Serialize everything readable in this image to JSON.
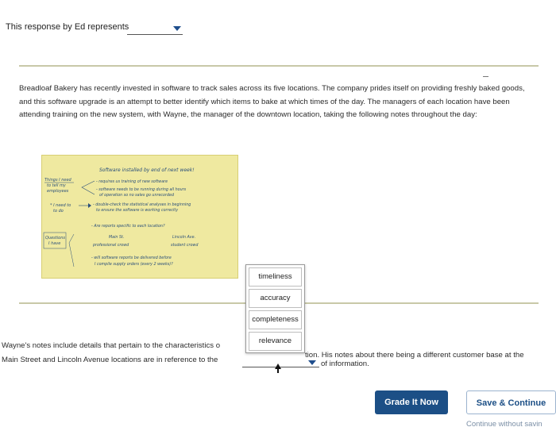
{
  "question": {
    "prompt": "This response by Ed represents",
    "paragraph": "Breadloaf Bakery has recently invested in software to track sales across its five locations. The company prides itself on providing freshly baked goods, and this software upgrade is an attempt to better identify which items to bake at which times of the day. The managers of each location have been attending training on the new system, with Wayne, the manager of the downtown location, taking the following notes throughout the day:"
  },
  "notes_card": {
    "title": "Software installed by end of next week!",
    "left_labels": [
      "Things I need to tell my employees",
      "* I need to do",
      "Questions I have"
    ],
    "lines": [
      "- requires us training of new software",
      "- software needs to be running during all hours",
      "of operation so no sales go unrecorded",
      "- double-check the statistical analyses in beginning",
      "to ensure the software is working correctly",
      "- Are reports specific to each location?",
      "Main St.",
      "Lincoln Ave.",
      "professional crowd",
      "student crowd",
      "- will software reports be delivered before",
      "I compile supply orders (every 2 weeks)?"
    ]
  },
  "dropdown": {
    "options": [
      "timeliness",
      "accuracy",
      "completeness",
      "relevance"
    ]
  },
  "answer": {
    "line1_start": "Wayne's notes include details that pertain to the characteristics o",
    "line1_end": "tion. His notes about there being a different customer base at the",
    "line2_start": "Main Street and Lincoln Avenue locations are in reference to the",
    "line2_end": "of information."
  },
  "buttons": {
    "grade": "Grade It Now",
    "save": "Save & Continue",
    "continue": "Continue without savin"
  },
  "colors": {
    "brand_blue": "#1c4f86",
    "note_yellow": "#efe9a0",
    "rule": "#c8c8a8"
  }
}
